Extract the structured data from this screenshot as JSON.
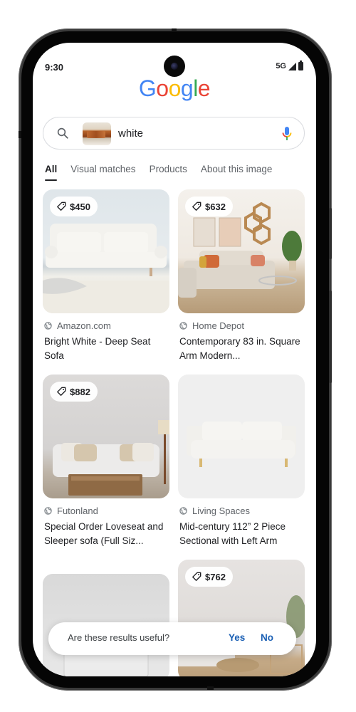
{
  "status_bar": {
    "time": "9:30",
    "network": "5G",
    "icons": [
      "signal-icon",
      "battery-icon"
    ]
  },
  "header": {
    "logo_letters": [
      {
        "char": "G",
        "color": "#4285F4"
      },
      {
        "char": "o",
        "color": "#EA4335"
      },
      {
        "char": "o",
        "color": "#FBBC05"
      },
      {
        "char": "g",
        "color": "#4285F4"
      },
      {
        "char": "l",
        "color": "#34A853"
      },
      {
        "char": "e",
        "color": "#EA4335"
      }
    ]
  },
  "search": {
    "query": "white",
    "icons": [
      "search-icon",
      "image-thumbnail",
      "mic-icon"
    ]
  },
  "tabs": [
    {
      "label": "All",
      "active": true
    },
    {
      "label": "Visual matches",
      "active": false
    },
    {
      "label": "Products",
      "active": false
    },
    {
      "label": "About this image",
      "active": false
    }
  ],
  "results": [
    {
      "price": "$450",
      "source": "Amazon.com",
      "title": "Bright White - Deep Seat Sofa"
    },
    {
      "price": "$632",
      "source": "Home Depot",
      "title": "Contemporary 83 in. Square Arm Modern..."
    },
    {
      "price": "$882",
      "source": "Futonland",
      "title": "Special Order Loveseat and Sleeper sofa (Full Siz..."
    },
    {
      "price": null,
      "source": "Living Spaces",
      "title": "Mid-century 112” 2 Piece Sectional with Left Arm"
    },
    {
      "price": null,
      "source": null,
      "title": null
    },
    {
      "price": "$762",
      "source": null,
      "title": null
    }
  ],
  "feedback": {
    "question": "Are these results useful?",
    "yes_label": "Yes",
    "no_label": "No"
  },
  "colors": {
    "link_blue": "#1a5fb4",
    "text_primary": "#202124",
    "text_secondary": "#5f6368"
  }
}
